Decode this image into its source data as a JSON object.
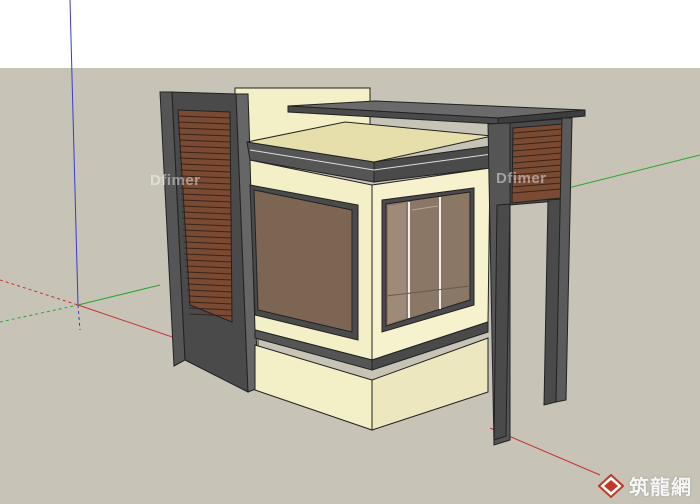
{
  "viewport": {
    "ground_color": "#c7c3b6",
    "sky_color": "#ffffff",
    "axis_colors": {
      "red": "#c83232",
      "green": "#2ea52e",
      "blue": "#3a3ad2"
    }
  },
  "model": {
    "wall_color": "#f3efc6",
    "frame_color": "#4a4a4a",
    "louver_color": "#7a4a33",
    "glass_color": "#7c6552"
  },
  "watermarks": {
    "left": "Dfimer",
    "right": "Dfimer"
  },
  "logo": {
    "icon": "zhulong-logo-icon",
    "text": "筑龍網",
    "color": "#c0392b"
  }
}
